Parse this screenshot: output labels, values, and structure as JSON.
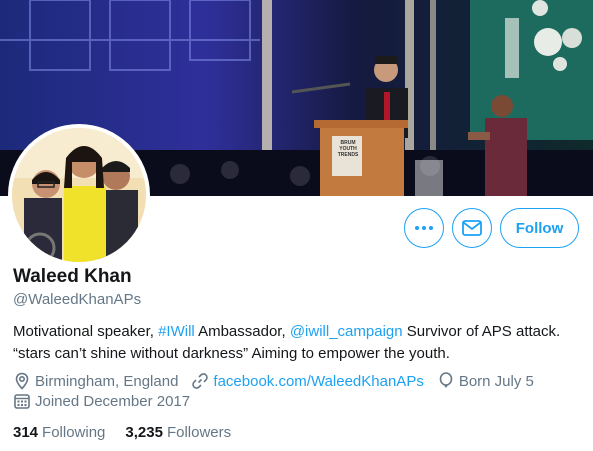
{
  "banner": {
    "podium_sign": [
      "BRUM",
      "YOUTH",
      "TRENDS"
    ]
  },
  "actions": {
    "more_icon": "more-dots-icon",
    "message_icon": "envelope-icon",
    "follow_label": "Follow"
  },
  "profile": {
    "name": "Waleed Khan",
    "handle": "@WaleedKhanAPs",
    "bio": {
      "p1": "Motivational speaker, ",
      "link1": "#IWill",
      "p2": " Ambassador, ",
      "link2": "@iwill_campaign",
      "p3": " Survivor of APS attack.",
      "line2": "“stars can’t shine without darkness” Aiming to empower the youth."
    },
    "location": "Birmingham, England",
    "website": "facebook.com/WaleedKhanAPs",
    "birthday": "Born July 5",
    "joined": "Joined December 2017"
  },
  "stats": {
    "following_count": "314",
    "following_label": "Following",
    "followers_count": "3,235",
    "followers_label": "Followers"
  },
  "colors": {
    "accent": "#1da1f2",
    "secondary_text": "#657786",
    "primary_text": "#14171a"
  }
}
